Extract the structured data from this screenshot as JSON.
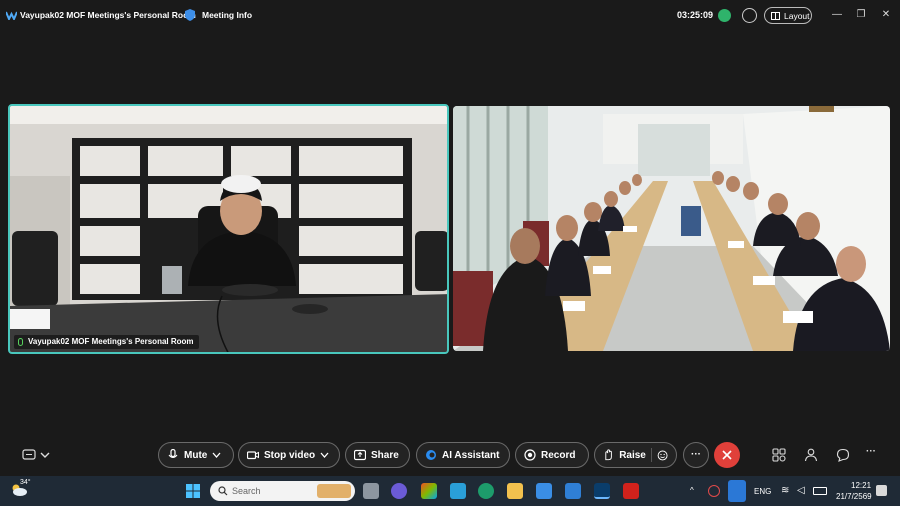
{
  "titlebar": {
    "room_title": "Vayupak02 MOF Meetings's Personal Room",
    "meeting_info": "Meeting Info",
    "elapsed": "03:25:09",
    "layout_label": "Layout",
    "icons": [
      "webex-logo-icon",
      "shield-icon",
      "network-status-icon",
      "zoom-icon",
      "layout-grid-icon",
      "minimize-icon",
      "restore-icon",
      "close-icon"
    ]
  },
  "tiles": {
    "left_name": "Vayupak02 MOF Meetings's Personal Room"
  },
  "controls": {
    "mute": "Mute",
    "stop_video": "Stop video",
    "share": "Share",
    "ai_assistant": "AI Assistant",
    "record": "Record",
    "raise": "Raise",
    "more": "···",
    "more_right": "···"
  },
  "taskbar": {
    "temperature": "34°",
    "search_placeholder": "Search",
    "language": "ENG",
    "time": "12:21",
    "date": "21/7/2569"
  },
  "colors": {
    "active_speaker_border": "#49c7bd",
    "end_call": "#e0403a",
    "background": "#1a1a1a"
  }
}
